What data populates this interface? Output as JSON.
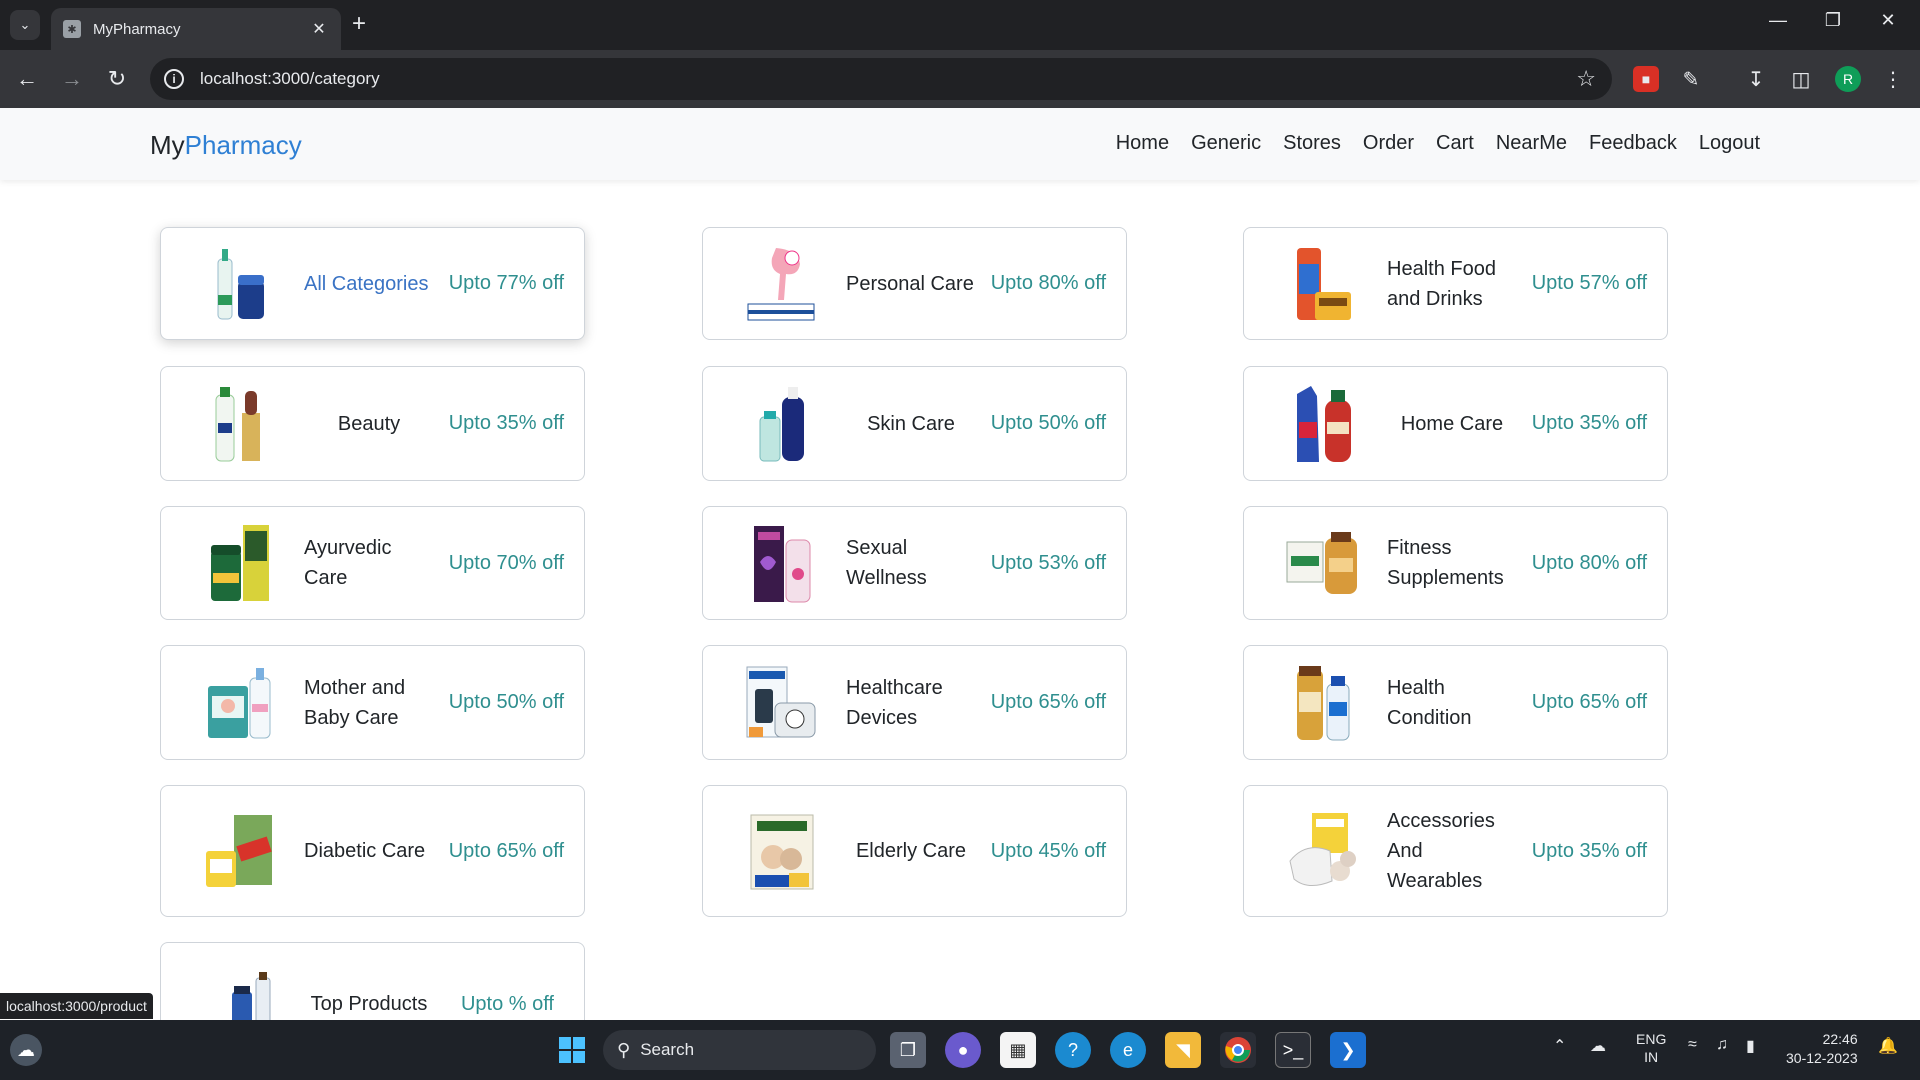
{
  "browser": {
    "tab_title": "MyPharmacy",
    "url": "localhost:3000/category",
    "status_url": "localhost:3000/product",
    "profile_initial": "R"
  },
  "site": {
    "brand_prefix": "My",
    "brand_accent": "Pharmacy",
    "nav": [
      "Home",
      "Generic",
      "Stores",
      "Order",
      "Cart",
      "NearMe",
      "Feedback",
      "Logout"
    ]
  },
  "categories": [
    {
      "name": "All Categories",
      "discount": "Upto 77% off"
    },
    {
      "name": "Personal Care",
      "discount": "Upto 80% off"
    },
    {
      "name": "Health Food and Drinks",
      "discount": "Upto 57% off"
    },
    {
      "name": "Beauty",
      "discount": "Upto 35% off"
    },
    {
      "name": "Skin Care",
      "discount": "Upto 50% off"
    },
    {
      "name": "Home Care",
      "discount": "Upto 35% off"
    },
    {
      "name": "Ayurvedic Care",
      "discount": "Upto 70% off"
    },
    {
      "name": "Sexual Wellness",
      "discount": "Upto 53% off"
    },
    {
      "name": "Fitness Supplements",
      "discount": "Upto 80% off"
    },
    {
      "name": "Mother and Baby Care",
      "discount": "Upto 50% off"
    },
    {
      "name": "Healthcare Devices",
      "discount": "Upto 65% off"
    },
    {
      "name": "Health Condition",
      "discount": "Upto 65% off"
    },
    {
      "name": "Diabetic Care",
      "discount": "Upto 65% off"
    },
    {
      "name": "Elderly Care",
      "discount": "Upto 45% off"
    },
    {
      "name": "Accessories And Wearables",
      "discount": "Upto 35% off"
    },
    {
      "name": "Top Products",
      "discount": "Upto % off"
    }
  ],
  "taskbar": {
    "search_label": "Search",
    "lang": "ENG",
    "region": "IN",
    "time": "22:46",
    "date": "30-12-2023"
  },
  "colors": {
    "brand_accent": "#2f80d4",
    "discount": "#2f8f8f",
    "active_category": "#3a73c4"
  }
}
